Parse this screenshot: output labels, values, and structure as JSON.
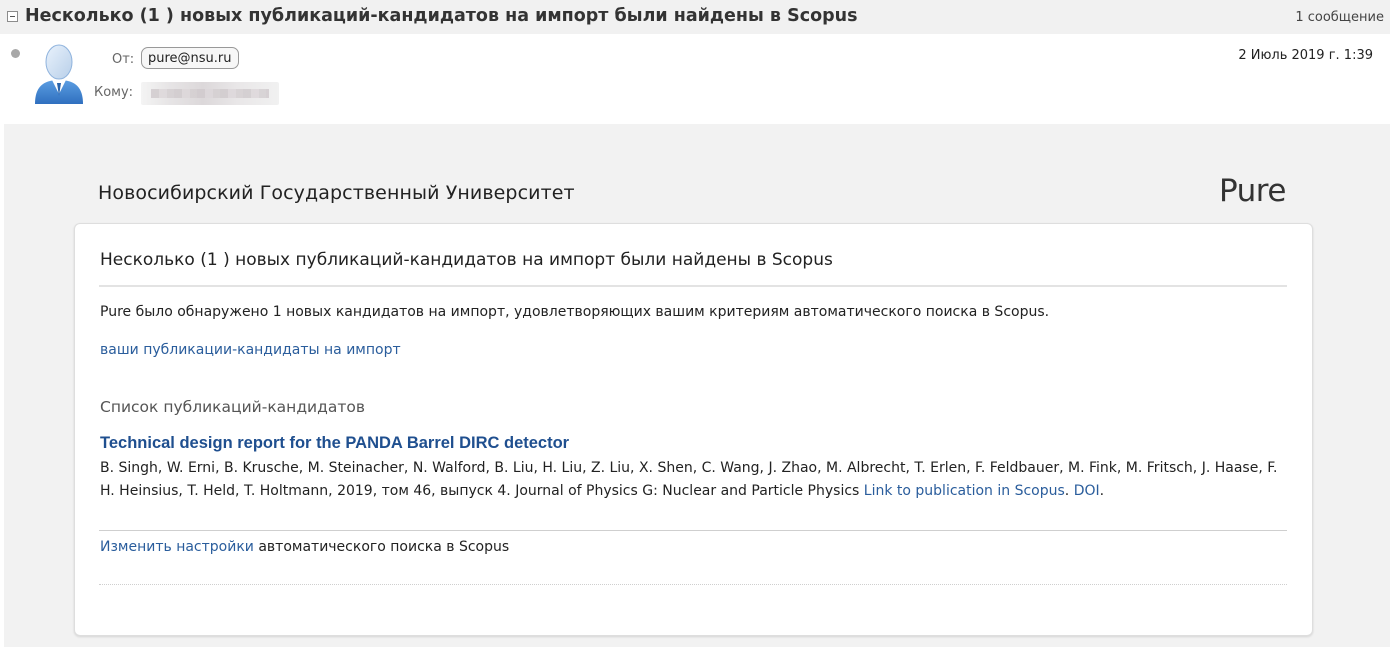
{
  "thread": {
    "title": "Несколько (1 ) новых публикаций-кандидатов на импорт были найдены в Scopus",
    "count": "1 сообщение"
  },
  "message": {
    "from_label": "От:",
    "from_address": "pure@nsu.ru",
    "to_label": "Кому:",
    "date": "2 Июль 2019 г. 1:39",
    "avatar_icon": "user-avatar-icon",
    "status_icon": "unread-dot-icon"
  },
  "email": {
    "org_name": "Новосибирский Государственный Университет",
    "logo": "Pure",
    "card_title": "Несколько (1 ) новых публикаций-кандидатов на импорт были найдены в Scopus",
    "intro": "Pure было обнаружено 1 новых кандидатов на импорт, удовлетворяющих вашим критериям автоматического поиска в Scopus.",
    "candidates_link": "ваши публикации-кандидаты на импорт",
    "section_heading": "Список публикаций-кандидатов",
    "publication": {
      "title": "Technical design report for the PANDA Barrel DIRC detector",
      "meta": "B. Singh, W. Erni, B. Krusche, M. Steinacher, N. Walford, B. Liu, H. Liu, Z. Liu, X. Shen, C. Wang, J. Zhao, M. Albrecht, T. Erlen, F. Feldbauer, M. Fink, M. Fritsch, J. Haase, F. H. Heinsius, T. Held, T. Holtmann, 2019, том 46, выпуск 4. Journal of Physics G: Nuclear and Particle Physics ",
      "scopus_link": "Link to publication in Scopus",
      "separator": ". ",
      "doi_link": "DOI",
      "end": "."
    },
    "settings_link": "Изменить настройки",
    "settings_text": " автоматического поиска в Scopus"
  },
  "colors": {
    "link": "#2a5d9c",
    "publication_title": "#1f4f8f",
    "avatar_blue": "#3a7cc9"
  }
}
